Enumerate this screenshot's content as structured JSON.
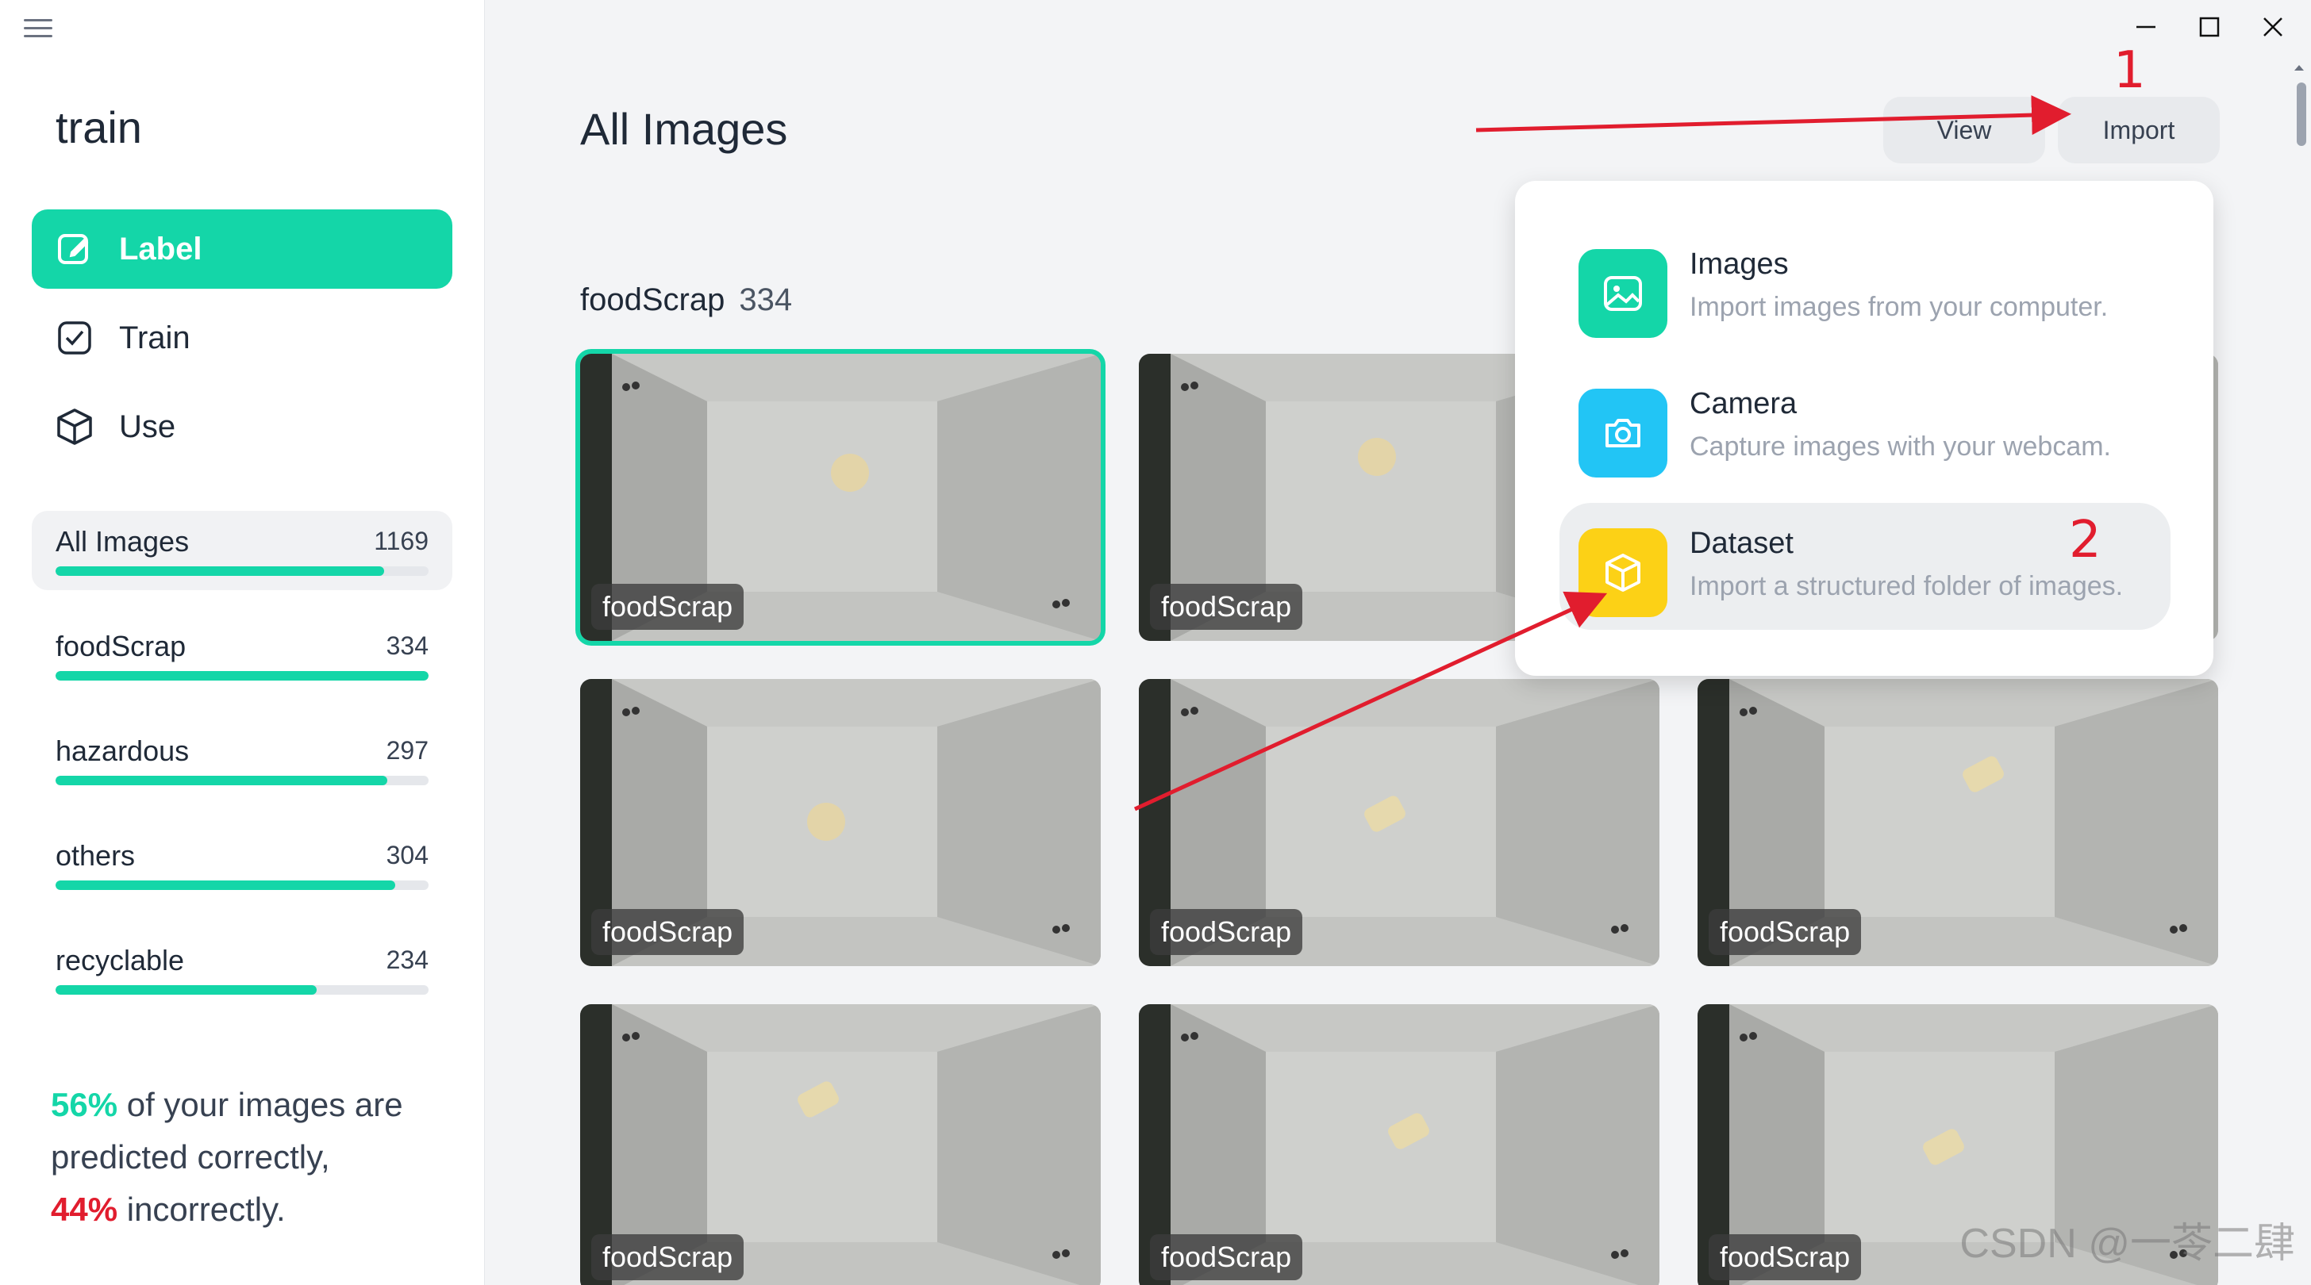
{
  "app": {
    "project_title": "train",
    "window_controls": [
      "minimize",
      "maximize",
      "close"
    ]
  },
  "sidebar": {
    "nav": [
      {
        "label": "Label",
        "icon": "edit-icon",
        "active": true
      },
      {
        "label": "Train",
        "icon": "checkbox-icon",
        "active": false
      },
      {
        "label": "Use",
        "icon": "cube-icon",
        "active": false
      }
    ],
    "filters": [
      {
        "name": "All Images",
        "count": "1169",
        "progress": 0.88,
        "active": true
      },
      {
        "name": "foodScrap",
        "count": "334",
        "progress": 1.0,
        "active": false
      },
      {
        "name": "hazardous",
        "count": "297",
        "progress": 0.89,
        "active": false
      },
      {
        "name": "others",
        "count": "304",
        "progress": 0.91,
        "active": false
      },
      {
        "name": "recyclable",
        "count": "234",
        "progress": 0.7,
        "active": false
      }
    ],
    "summary": {
      "correct_pct": "56%",
      "line1": " of your images are",
      "line2": "predicted correctly,",
      "incorrect_pct": "44%",
      "line3": " incorrectly."
    }
  },
  "main": {
    "title": "All Images",
    "view_label": "View",
    "import_label": "Import",
    "group": {
      "name": "foodScrap",
      "count": "334"
    },
    "cards": [
      "foodScrap",
      "foodScrap",
      "foodScrap",
      "foodScrap",
      "foodScrap",
      "foodScrap",
      "foodScrap",
      "foodScrap",
      "foodScrap"
    ]
  },
  "import_menu": {
    "items": [
      {
        "title": "Images",
        "desc": "Import images from your computer.",
        "color": "#14d6a8",
        "icon": "image-icon"
      },
      {
        "title": "Camera",
        "desc": "Capture images with your webcam.",
        "color": "#22c5f5",
        "icon": "camera-icon"
      },
      {
        "title": "Dataset",
        "desc": "Import a structured folder of images.",
        "color": "#fcd116",
        "icon": "dataset-cube-icon"
      }
    ]
  },
  "annotations": {
    "step1": "1",
    "step2": "2"
  },
  "watermark": "CSDN @一苓二肆",
  "colors": {
    "accent": "#14d6a8",
    "annotation_red": "#e11d2e"
  }
}
